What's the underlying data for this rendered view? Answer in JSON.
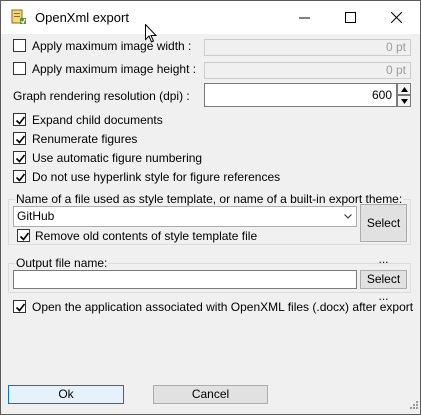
{
  "window": {
    "title": "OpenXml export"
  },
  "options": {
    "max_width": {
      "label": "Apply maximum image width :",
      "checked": false,
      "value": "0 pt"
    },
    "max_height": {
      "label": "Apply maximum image height :",
      "checked": false,
      "value": "0 pt"
    },
    "resolution": {
      "label": "Graph rendering resolution (dpi) :",
      "value": "600"
    },
    "expand_child": {
      "label": "Expand child documents",
      "checked": true
    },
    "renumerate": {
      "label": "Renumerate figures",
      "checked": true
    },
    "auto_numbering": {
      "label": "Use automatic figure numbering",
      "checked": true
    },
    "no_hyperlink": {
      "label": "Do not use hyperlink style for figure references",
      "checked": true
    }
  },
  "style_template": {
    "group_label": "Name of a file used as style template, or name of a built-in export theme:",
    "selected": "GitHub",
    "select_label": "Select ...",
    "remove_old": {
      "label": "Remove old contents of style template file",
      "checked": true
    }
  },
  "output": {
    "group_label": "Output file name:",
    "value": "",
    "select_label": "Select ..."
  },
  "open_app": {
    "label": "Open the application associated with OpenXML files (.docx) after export",
    "checked": true
  },
  "buttons": {
    "ok": "Ok",
    "cancel": "Cancel"
  },
  "icons": {
    "app": "openxml-export-icon",
    "minimize": "minimize-icon",
    "maximize": "maximize-icon",
    "close": "close-icon",
    "dropdown": "chevron-down-icon",
    "cursor": "mouse-cursor-icon",
    "grip": "resize-grip-icon"
  }
}
